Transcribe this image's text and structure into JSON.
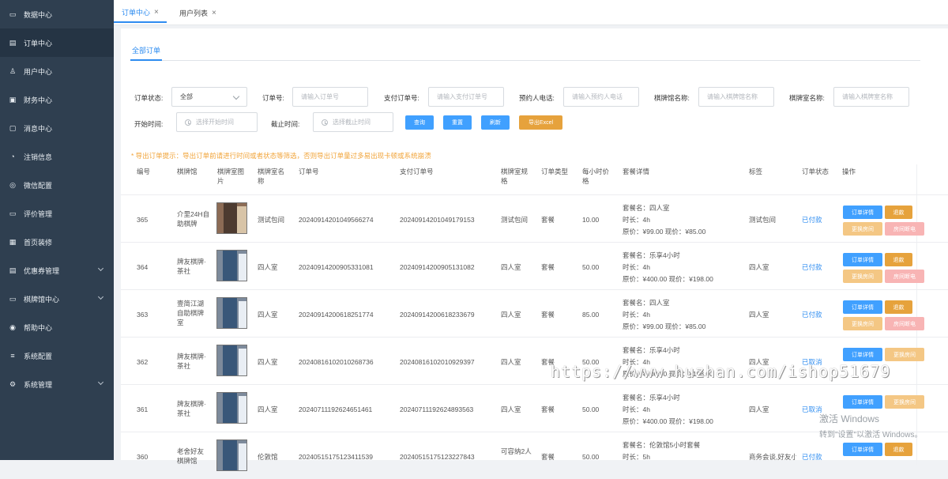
{
  "sidebar": {
    "items": [
      {
        "label": "数据中心",
        "icon": "dashboard-icon"
      },
      {
        "label": "订单中心",
        "icon": "order-icon"
      },
      {
        "label": "用户中心",
        "icon": "user-icon"
      },
      {
        "label": "财务中心",
        "icon": "wallet-icon"
      },
      {
        "label": "消息中心",
        "icon": "message-icon"
      },
      {
        "label": "注销信息",
        "icon": "pie-chart-icon"
      },
      {
        "label": "微信配置",
        "icon": "wechat-icon"
      },
      {
        "label": "评价管理",
        "icon": "comment-icon"
      },
      {
        "label": "首页装修",
        "icon": "home-design-icon"
      },
      {
        "label": "优惠券管理",
        "icon": "coupon-icon"
      },
      {
        "label": "棋牌馆中心",
        "icon": "monitor-icon"
      },
      {
        "label": "帮助中心",
        "icon": "help-icon"
      },
      {
        "label": "系统配置",
        "icon": "list-icon"
      },
      {
        "label": "系统管理",
        "icon": "settings-icon"
      }
    ]
  },
  "tabs": [
    {
      "label": "订单中心",
      "close": "×"
    },
    {
      "label": "用户列表",
      "close": "×"
    }
  ],
  "page": {
    "subtab": "全部订单"
  },
  "filters": {
    "order_status_label": "订单状态:",
    "order_status_value": "全部",
    "order_no_label": "订单号:",
    "order_no_placeholder": "请输入订单号",
    "pay_no_label": "支付订单号:",
    "pay_no_placeholder": "请输入支付订单号",
    "phone_label": "预约人电话:",
    "phone_placeholder": "请输入预约人电话",
    "hall_label": "棋牌馆名称:",
    "hall_placeholder": "请输入棋牌馆名称",
    "room_label": "棋牌室名称:",
    "room_placeholder": "请输入棋牌室名称",
    "start_label": "开始时间:",
    "start_placeholder": "选择开始时间",
    "end_label": "截止时间:",
    "end_placeholder": "选择截止时间",
    "buttons": [
      "查询",
      "重置",
      "刷新",
      "导出Excel"
    ]
  },
  "tip": "* 导出订单提示：导出订单前请进行时间或者状态等筛选，否则导出订单量过多易出现卡顿或系统崩溃",
  "table": {
    "headers": [
      "编号",
      "棋牌馆",
      "棋牌室图片",
      "棋牌室名称",
      "订单号",
      "支付订单号",
      "棋牌室规格",
      "订单类型",
      "每小时价格",
      "套餐详情",
      "标签",
      "订单状态",
      "操作"
    ],
    "rows": [
      {
        "id": "365",
        "hall": "介里24H自助棋牌",
        "room": "测试包间",
        "order": "20240914201049566274",
        "pay": "20240914201049179153",
        "spec": "测试包间",
        "type": "套餐",
        "price": "10.00",
        "pkg": "套餐名：四人室",
        "dur": "时长：4h",
        "cost": "原价：¥99.00    现价：¥85.00",
        "tag": "测试包间",
        "status": "已付款",
        "buttons": [
          "订单详情",
          "退款",
          "更换房间",
          "房间断电"
        ]
      },
      {
        "id": "364",
        "hall": "牌友棋牌·茶社",
        "room": "四人室",
        "order": "20240914200905331081",
        "pay": "20240914200905131082",
        "spec": "四人室",
        "type": "套餐",
        "price": "50.00",
        "pkg": "套餐名：乐享4小时",
        "dur": "时长：4h",
        "cost": "原价：¥400.00    现价：¥198.00",
        "tag": "四人室",
        "status": "已付款",
        "buttons": [
          "订单详情",
          "退款",
          "更换房间",
          "房间断电"
        ]
      },
      {
        "id": "363",
        "hall": "壹简江湖自助棋牌室",
        "room": "四人室",
        "order": "20240914200618251774",
        "pay": "20240914200618233679",
        "spec": "四人室",
        "type": "套餐",
        "price": "85.00",
        "pkg": "套餐名：四人室",
        "dur": "时长：4h",
        "cost": "原价：¥99.00    现价：¥85.00",
        "tag": "四人室",
        "status": "已付款",
        "buttons": [
          "订单详情",
          "退款",
          "更换房间",
          "房间断电"
        ]
      },
      {
        "id": "362",
        "hall": "牌友棋牌·茶社",
        "room": "四人室",
        "order": "20240816102010268736",
        "pay": "20240816102010929397",
        "spec": "四人室",
        "type": "套餐",
        "price": "50.00",
        "pkg": "套餐名：乐享4小时",
        "dur": "时长：4h",
        "cost": "原价：¥400.00    现价：¥198.00",
        "tag": "四人室",
        "status": "已取消",
        "buttons": [
          "订单详情",
          "更换房间"
        ]
      },
      {
        "id": "361",
        "hall": "牌友棋牌·茶社",
        "room": "四人室",
        "order": "20240711192624651461",
        "pay": "20240711192624893563",
        "spec": "四人室",
        "type": "套餐",
        "price": "50.00",
        "pkg": "套餐名：乐享4小时",
        "dur": "时长：4h",
        "cost": "原价：¥400.00    现价：¥198.00",
        "tag": "四人室",
        "status": "已取消",
        "buttons": [
          "订单详情",
          "更换房间"
        ]
      },
      {
        "id": "360",
        "hall": "老舍好友棋牌馆",
        "room": "伦敦馆",
        "order": "20240515175123411539",
        "pay": "20240515175123227843",
        "spec": "可容纳2人",
        "type": "套餐",
        "price": "50.00",
        "pkg": "套餐名：伦敦馆5小时套餐",
        "dur": "时长：5h",
        "cost": "",
        "tag": "商务会谈,好友小",
        "status": "已付款",
        "buttons": [
          "订单详情",
          "退款"
        ]
      }
    ]
  },
  "overlay": {
    "watermark": "https://www.huzhan.com/ishop51679",
    "activate_title": "激活 Windows",
    "activate_sub": "转到\"设置\"以激活 Windows。"
  }
}
